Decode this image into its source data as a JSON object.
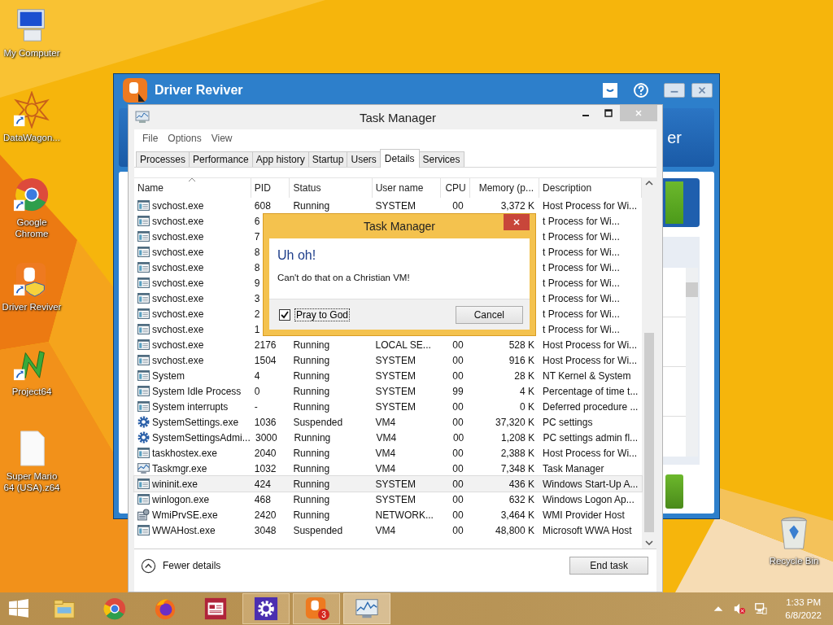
{
  "desktop_icons": [
    {
      "label": "My Computer",
      "kind": "computer",
      "shortcut": false
    },
    {
      "label": "DataWagon...",
      "kind": "star",
      "shortcut": true
    },
    {
      "label": "Google Chrome",
      "kind": "chrome",
      "shortcut": true
    },
    {
      "label": "Driver Reviver",
      "kind": "reviver",
      "shortcut": true
    },
    {
      "label": "Project64",
      "kind": "project",
      "shortcut": true
    },
    {
      "label": "Super Mario 64 (USA).z64",
      "kind": "file",
      "shortcut": false
    }
  ],
  "recycle_bin": {
    "label": "Recycle Bin"
  },
  "driver_reviver": {
    "title": "Driver Reviver",
    "header_fragment": "er"
  },
  "task_manager": {
    "title": "Task Manager",
    "menu": [
      "File",
      "Options",
      "View"
    ],
    "tabs": [
      {
        "label": "Processes",
        "selected": false
      },
      {
        "label": "Performance",
        "selected": false
      },
      {
        "label": "App history",
        "selected": false
      },
      {
        "label": "Startup",
        "selected": false
      },
      {
        "label": "Users",
        "selected": false
      },
      {
        "label": "Details",
        "selected": true
      },
      {
        "label": "Services",
        "selected": false
      }
    ],
    "columns": [
      {
        "label": "Name",
        "sorted": true
      },
      {
        "label": "PID",
        "sorted": false
      },
      {
        "label": "Status",
        "sorted": false
      },
      {
        "label": "User name",
        "sorted": false
      },
      {
        "label": "CPU",
        "sorted": false
      },
      {
        "label": "Memory (p...",
        "sorted": false
      },
      {
        "label": "Description",
        "sorted": false
      }
    ],
    "rows": [
      {
        "kind": "window",
        "name": "svchost.exe",
        "pid": "608",
        "status": "Running",
        "user": "SYSTEM",
        "cpu": "00",
        "memory": "3,372 K",
        "description": "Host Process for Wi...",
        "selected": false
      },
      {
        "kind": "window",
        "name": "svchost.exe",
        "pid": "6",
        "description": "t Process for Wi...",
        "selected": false
      },
      {
        "kind": "window",
        "name": "svchost.exe",
        "pid": "7",
        "description": "t Process for Wi...",
        "selected": false
      },
      {
        "kind": "window",
        "name": "svchost.exe",
        "pid": "8",
        "description": "t Process for Wi...",
        "selected": false
      },
      {
        "kind": "window",
        "name": "svchost.exe",
        "pid": "8",
        "description": "t Process for Wi...",
        "selected": false
      },
      {
        "kind": "window",
        "name": "svchost.exe",
        "pid": "9",
        "description": "t Process for Wi...",
        "selected": false
      },
      {
        "kind": "window",
        "name": "svchost.exe",
        "pid": "3",
        "description": "t Process for Wi...",
        "selected": false
      },
      {
        "kind": "window",
        "name": "svchost.exe",
        "pid": "2",
        "description": "t Process for Wi...",
        "selected": false
      },
      {
        "kind": "window",
        "name": "svchost.exe",
        "pid": "1",
        "description": "t Process for Wi...",
        "selected": false
      },
      {
        "kind": "window",
        "name": "svchost.exe",
        "pid": "2176",
        "status": "Running",
        "user": "LOCAL SE...",
        "cpu": "00",
        "memory": "528 K",
        "description": "Host Process for Wi...",
        "selected": false
      },
      {
        "kind": "window",
        "name": "svchost.exe",
        "pid": "1504",
        "status": "Running",
        "user": "SYSTEM",
        "cpu": "00",
        "memory": "916 K",
        "description": "Host Process for Wi...",
        "selected": false
      },
      {
        "kind": "window",
        "name": "System",
        "pid": "4",
        "status": "Running",
        "user": "SYSTEM",
        "cpu": "00",
        "memory": "28 K",
        "description": "NT Kernel & System",
        "selected": false
      },
      {
        "kind": "window",
        "name": "System Idle Process",
        "pid": "0",
        "status": "Running",
        "user": "SYSTEM",
        "cpu": "99",
        "memory": "4 K",
        "description": "Percentage of time t...",
        "selected": false
      },
      {
        "kind": "window",
        "name": "System interrupts",
        "pid": "-",
        "status": "Running",
        "user": "SYSTEM",
        "cpu": "00",
        "memory": "0 K",
        "description": "Deferred procedure ...",
        "selected": false
      },
      {
        "kind": "gear",
        "name": "SystemSettings.exe",
        "pid": "1036",
        "status": "Suspended",
        "user": "VM4",
        "cpu": "00",
        "memory": "37,320 K",
        "description": "PC settings",
        "selected": false
      },
      {
        "kind": "gear",
        "name": "SystemSettingsAdmi...",
        "pid": "3000",
        "status": "Running",
        "user": "VM4",
        "cpu": "00",
        "memory": "1,208 K",
        "description": "PC settings admin fl...",
        "selected": false
      },
      {
        "kind": "window",
        "name": "taskhostex.exe",
        "pid": "2040",
        "status": "Running",
        "user": "VM4",
        "cpu": "00",
        "memory": "2,388 K",
        "description": "Host Process for Wi...",
        "selected": false
      },
      {
        "kind": "chart",
        "name": "Taskmgr.exe",
        "pid": "1032",
        "status": "Running",
        "user": "VM4",
        "cpu": "00",
        "memory": "7,348 K",
        "description": "Task Manager",
        "selected": false
      },
      {
        "kind": "window",
        "name": "wininit.exe",
        "pid": "424",
        "status": "Running",
        "user": "SYSTEM",
        "cpu": "00",
        "memory": "436 K",
        "description": "Windows Start-Up A...",
        "selected": true
      },
      {
        "kind": "window",
        "name": "winlogon.exe",
        "pid": "468",
        "status": "Running",
        "user": "SYSTEM",
        "cpu": "00",
        "memory": "632 K",
        "description": "Windows Logon Ap...",
        "selected": false
      },
      {
        "kind": "service",
        "name": "WmiPrvSE.exe",
        "pid": "2420",
        "status": "Running",
        "user": "NETWORK...",
        "cpu": "00",
        "memory": "3,464 K",
        "description": "WMI Provider Host",
        "selected": false
      },
      {
        "kind": "window",
        "name": "WWAHost.exe",
        "pid": "3048",
        "status": "Suspended",
        "user": "VM4",
        "cpu": "00",
        "memory": "48,800 K",
        "description": "Microsoft WWA Host",
        "selected": false
      }
    ],
    "fewer_details": "Fewer details",
    "end_task": "End task"
  },
  "dialog": {
    "title": "Task Manager",
    "heading": "Uh oh!",
    "message": "Can't do that on a Christian VM!",
    "checkbox": {
      "label": "Pray to God",
      "checked": true
    },
    "cancel": "Cancel"
  },
  "taskbar": {
    "apps": [
      {
        "kind": "explorer",
        "running": false,
        "focused": false
      },
      {
        "kind": "chrome",
        "running": false,
        "focused": false
      },
      {
        "kind": "firefox",
        "running": false,
        "focused": false
      },
      {
        "kind": "news",
        "running": false,
        "focused": false
      },
      {
        "kind": "settings",
        "running": true,
        "focused": false
      },
      {
        "kind": "reviver",
        "running": true,
        "focused": false,
        "badge": "3"
      },
      {
        "kind": "taskmgr",
        "running": true,
        "focused": true
      }
    ],
    "time": "1:33 PM",
    "date": "6/8/2022"
  }
}
